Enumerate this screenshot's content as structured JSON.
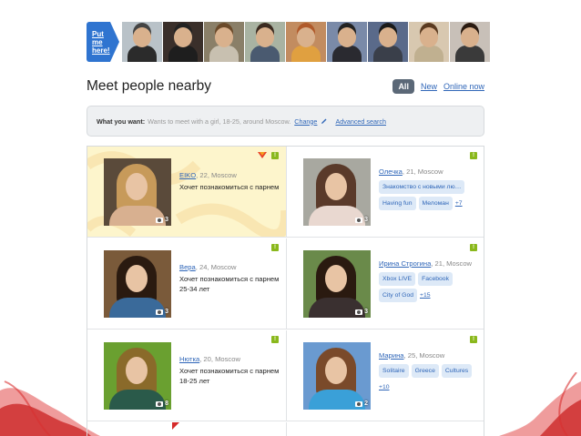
{
  "promo": {
    "button_label": "Put me here!",
    "thumbs": [
      {
        "bg": "#b9c2c8",
        "body": "#2b2b2b",
        "hair": "#444"
      },
      {
        "bg": "#3a2f2a",
        "body": "#1e1e1e",
        "hair": "#222"
      },
      {
        "bg": "#8a7f68",
        "body": "#c8c0b0",
        "hair": "#6b4a2a"
      },
      {
        "bg": "#a9b3a2",
        "body": "#4a5a70",
        "hair": "#3a2a20"
      },
      {
        "bg": "#c28c60",
        "body": "#e0a040",
        "hair": "#b05a2a"
      },
      {
        "bg": "#7a8aa8",
        "body": "#2a2a30",
        "hair": "#222"
      },
      {
        "bg": "#5a6a8a",
        "body": "#3a3f4a",
        "hair": "#1a1a1a"
      },
      {
        "bg": "#d8c8b0",
        "body": "#c0b090",
        "hair": "#5a3a20"
      },
      {
        "bg": "#c8c0b8",
        "body": "#3a3a3a",
        "hair": "#2a1a10"
      }
    ]
  },
  "header": {
    "title": "Meet people nearby",
    "filter_all": "All",
    "filter_new": "New",
    "filter_online": "Online now"
  },
  "want_bar": {
    "label": "What you want:",
    "text": "Wants to meet with a girl, 18-25, around Moscow.",
    "change": "Change",
    "advanced": "Advanced search"
  },
  "colors": {
    "accent": "#2f74d0",
    "link": "#2f66b8",
    "badge": "#8ab81c",
    "highlight": "#fdf5cc"
  },
  "people": [
    {
      "name": "EIKO",
      "meta": ", 22, Moscow",
      "seek": "Хочет познакомиться с парнем",
      "photos": "3",
      "highlight": true,
      "photo": {
        "bg": "#5a4a3a",
        "hair": "#c79a5a",
        "shoulder": "#d8b090"
      }
    },
    {
      "name": "Олечка",
      "meta": ", 21, Moscow",
      "photos": "3",
      "tags": [
        "Знакомство с новыми лю…",
        "Having fun",
        "Меломан"
      ],
      "more": "+7",
      "photo": {
        "bg": "#a8a8a0",
        "hair": "#5a3a2a",
        "shoulder": "#e9d8d0"
      }
    },
    {
      "name": "Вера",
      "meta": ", 24, Moscow",
      "seek": "Хочет познакомиться с парнем 25-34 лет",
      "photos": "3",
      "photo": {
        "bg": "#7a5a3a",
        "hair": "#2a1a10",
        "shoulder": "#3a6a9a"
      }
    },
    {
      "name": "Ирина Строгина",
      "meta": ", 21, Moscow",
      "photos": "3",
      "tags": [
        "Xbox LIVE",
        "Facebook",
        "City of God"
      ],
      "more": "+15",
      "photo": {
        "bg": "#6a8a4a",
        "hair": "#2a1a10",
        "shoulder": "#3a3030"
      }
    },
    {
      "name": "Нютка",
      "meta": ", 20, Moscow",
      "seek": "Хочет познакомиться с парнем 18-25 лет",
      "photos": "8",
      "photo": {
        "bg": "#6aa030",
        "hair": "#8a6a2a",
        "shoulder": "#2a5a4a"
      }
    },
    {
      "name": "Марина",
      "meta": ", 25, Moscow",
      "photos": "2",
      "tags": [
        "Solitaire",
        "Greece",
        "Cultures"
      ],
      "more": "+10",
      "photo": {
        "bg": "#6a9ad0",
        "hair": "#7a4a2a",
        "shoulder": "#3aa0d8"
      }
    }
  ]
}
